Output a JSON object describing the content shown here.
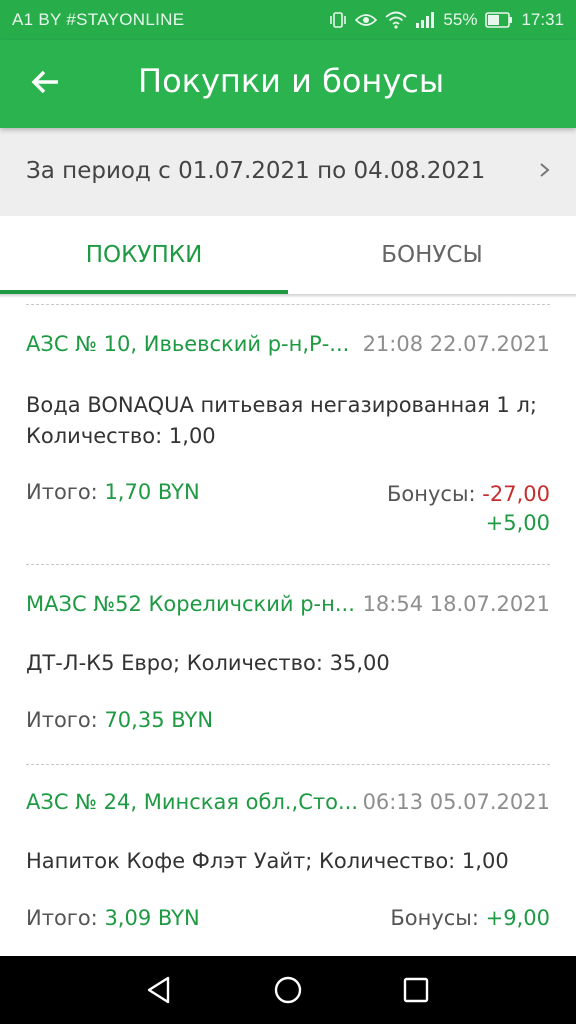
{
  "status_bar": {
    "carrier": "A1 BY #STAYONLINE",
    "battery": "55%",
    "time": "17:31",
    "icons": [
      "vibrate-icon",
      "eye-icon",
      "wifi-icon",
      "signal-icon",
      "battery-icon"
    ]
  },
  "app_bar": {
    "title": "Покупки и бонусы",
    "back_icon": "arrow-left-icon"
  },
  "period": {
    "label": "За период с 01.07.2021 по 04.08.2021",
    "chevron_icon": "chevron-right-icon"
  },
  "tabs": [
    {
      "label": "ПОКУПКИ",
      "selected": true
    },
    {
      "label": "БОНУСЫ",
      "selected": false
    }
  ],
  "purchases": [
    {
      "station": "АЗС № 10, Ивьевский р-н,Р-...",
      "datetime": "21:08 22.07.2021",
      "product_line1": "Вода BONAQUA питьевая негазированная 1 л;",
      "product_line2": "Количество: 1,00",
      "total_label": "Итого:",
      "total_value": "1,70 BYN",
      "bonus_label": "Бонусы:",
      "bonus_neg": "-27,00",
      "bonus_pos": "+5,00"
    },
    {
      "station": "МАЗС №52 Кореличский р-н...",
      "datetime": "18:54 18.07.2021",
      "product_line1": "ДТ-Л-К5 Евро; Количество: 35,00",
      "total_label": "Итого:",
      "total_value": "70,35 BYN"
    },
    {
      "station": "АЗС № 24, Минская обл.,Сто...",
      "datetime": "06:13 05.07.2021",
      "product_line1": "Напиток Кофе Флэт Уайт; Количество: 1,00",
      "total_label": "Итого:",
      "total_value": "3,09 BYN",
      "bonus_label": "Бонусы:",
      "bonus_pos": "+9,00"
    }
  ],
  "nav_bar": {
    "icons": [
      "back-triangle-icon",
      "home-circle-icon",
      "recents-square-icon"
    ]
  },
  "colors": {
    "brand_green": "#2ab34f",
    "status_green": "#27ae4b",
    "text_green": "#1e9a43",
    "negative_red": "#c62d2d"
  }
}
